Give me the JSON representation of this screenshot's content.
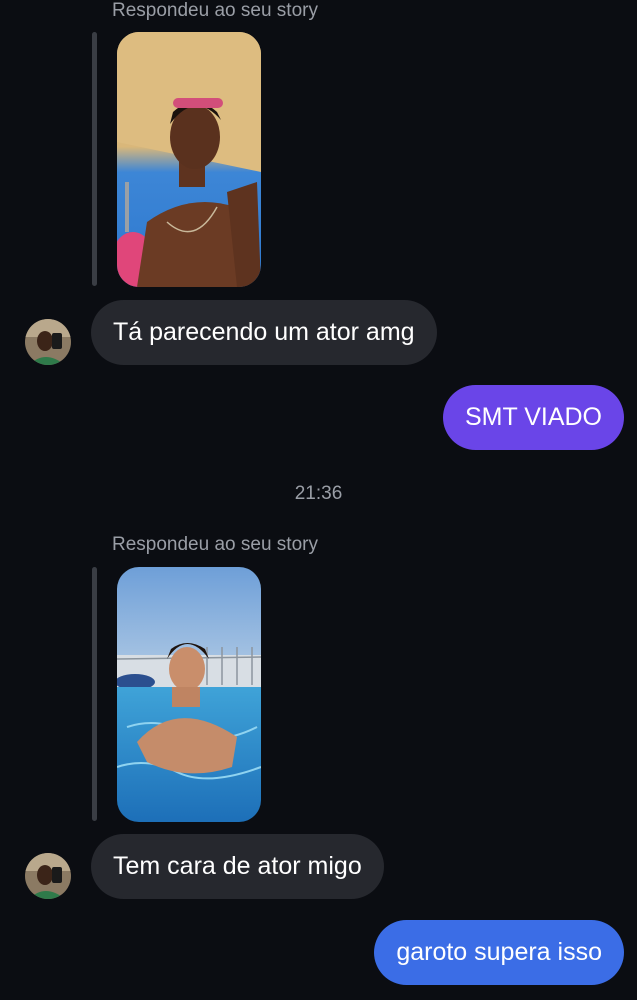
{
  "conversation": {
    "story_reply_1": {
      "label": "Respondeu ao seu story"
    },
    "message_in_1": "Tá parecendo um ator amg",
    "message_out_1": "SMT VIADO",
    "timestamp": "21:36",
    "story_reply_2": {
      "label": "Respondeu ao seu story"
    },
    "message_in_2": "Tem cara de ator migo",
    "message_out_2": "garoto supera isso"
  },
  "colors": {
    "background": "#0b0d12",
    "incoming_bubble": "#26282e",
    "outgoing_bubble_1": "#6a45e8",
    "outgoing_bubble_2": "#3b6de6",
    "secondary_text": "#9a9ea6"
  },
  "icons": {
    "avatar": "contact-avatar-photo"
  }
}
